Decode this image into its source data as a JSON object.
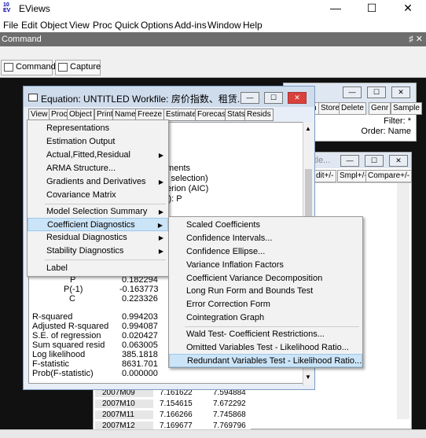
{
  "app": {
    "title": "EViews",
    "minimize": "—",
    "maximize": "☐",
    "close": "✕"
  },
  "menubar": [
    "File",
    "Edit",
    "Object",
    "View",
    "Proc",
    "Quick",
    "Options",
    "Add-ins",
    "Window",
    "Help"
  ],
  "command": {
    "label": "Command",
    "pin": "♯",
    "close": "✕",
    "tabs": [
      "Command",
      "Capture"
    ]
  },
  "bgwin1": {
    "toolbar": [
      "ch",
      "Store",
      "Delete",
      "Genr",
      "Sample"
    ],
    "filter": "Filter: *",
    "order": "Order: Name"
  },
  "bgwin2": {
    "title": "itle...",
    "toolbar": [
      "dit+/-",
      "Smpl+/-",
      "Compare+/-"
    ],
    "rows": [
      [
        "2007M09",
        "7.161622",
        "7.594884"
      ],
      [
        "2007M10",
        "7.154615",
        "7.672292"
      ],
      [
        "2007M11",
        "7.166266",
        "7.745868"
      ],
      [
        "2007M12",
        "7.169677",
        "7.769796"
      ]
    ]
  },
  "equation": {
    "title": "Equation: UNTITLED   Workfile: 房价指数、租赁...",
    "toolbar": [
      "View",
      "Proc",
      "Object",
      "Print",
      "Name",
      "Freeze",
      "Estimate",
      "Forecast",
      "Stats",
      "Resids"
    ],
    "partial": [
      "tments",
      "c selection)",
      "terion (AIC)",
      "c): P"
    ],
    "coef": [
      {
        "name": "P",
        "value": "0.182294"
      },
      {
        "name": "P(-1)",
        "value": "-0.163773"
      },
      {
        "name": "C",
        "value": "0.223326"
      }
    ],
    "stats": [
      {
        "name": "R-squared",
        "value": "0.994203"
      },
      {
        "name": "Adjusted R-squared",
        "value": "0.994087"
      },
      {
        "name": "S.E. of regression",
        "value": "0.020427"
      },
      {
        "name": "Sum squared resid",
        "value": "0.063005"
      },
      {
        "name": "Log likelihood",
        "value": "385.1818"
      },
      {
        "name": "F-statistic",
        "value": "8631.701"
      },
      {
        "name": "Prob(F-statistic)",
        "value": "0.000000"
      }
    ]
  },
  "viewmenu": [
    "Representations",
    "Estimation Output",
    "Actual,Fitted,Residual",
    "ARMA Structure...",
    "Gradients and Derivatives",
    "Covariance Matrix",
    "Model Selection Summary",
    "Coefficient Diagnostics",
    "Residual Diagnostics",
    "Stability Diagnostics",
    "Label"
  ],
  "submenu": [
    "Scaled Coefficients",
    "Confidence Intervals...",
    "Confidence Ellipse...",
    "Variance Inflation Factors",
    "Coefficient Variance Decomposition",
    "Long Run Form and Bounds Test",
    "Error Correction Form",
    "Cointegration Graph",
    "Wald Test- Coefficient Restrictions...",
    "Omitted Variables Test - Likelihood Ratio...",
    "Redundant Variables Test - Likelihood Ratio..."
  ]
}
